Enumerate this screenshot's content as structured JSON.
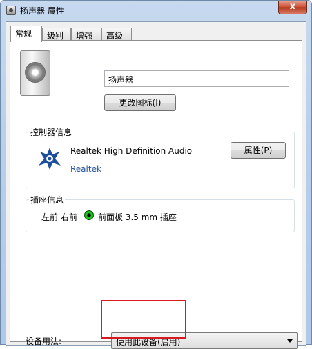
{
  "window": {
    "title": "扬声器 属性",
    "close_label": "x"
  },
  "tabs": [
    {
      "label": "常规"
    },
    {
      "label": "级别"
    },
    {
      "label": "增强"
    },
    {
      "label": "高级"
    }
  ],
  "general": {
    "device_name": "扬声器",
    "change_icon_label": "更改图标(I)"
  },
  "controller": {
    "group_label": "控制器信息",
    "name": "Realtek High Definition Audio",
    "vendor": "Realtek",
    "properties_label": "属性(P)"
  },
  "jack": {
    "group_label": "插座信息",
    "position": "左前 右前",
    "description": "前面板 3.5 mm 插座",
    "color": "#1ec21e"
  },
  "device_usage": {
    "label": "设备用法:",
    "selected": "使用此设备(启用)"
  },
  "annotation": {
    "highlight_color": "#d8191f"
  }
}
